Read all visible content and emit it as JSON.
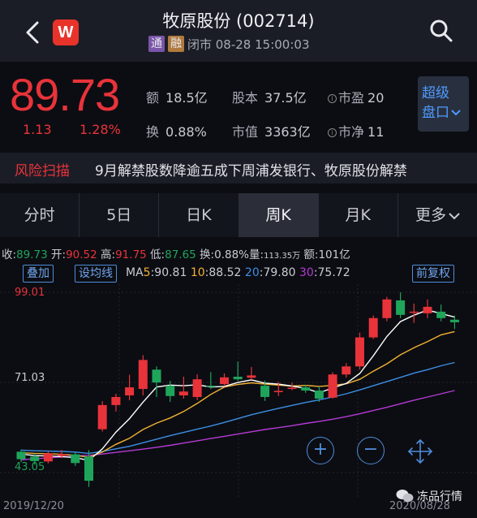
{
  "header": {
    "title": "牧原股份 (002714)",
    "badge_tong": "通",
    "badge_rong": "融",
    "status": "闭市 08-28 15:00:03",
    "logo": "W"
  },
  "quote": {
    "price": "89.73",
    "change": "1.13",
    "change_pct": "1.28%",
    "amount_label": "额",
    "amount": "18.5亿",
    "capital_label": "股本",
    "capital": "37.5亿",
    "pe_label": "市盈",
    "pe": "20",
    "turnover_label": "换",
    "turnover": "0.88%",
    "mcap_label": "市值",
    "mcap": "3363亿",
    "pb_label": "市净",
    "pb": "11",
    "super_line1": "超级",
    "super_line2": "盘口"
  },
  "risk": {
    "label": "风险扫描",
    "text": "9月解禁股数降逾五成下周浦发银行、牧原股份解禁"
  },
  "tabs": [
    "分时",
    "5日",
    "日K",
    "周K",
    "月K",
    "更多"
  ],
  "kinfo": {
    "close_label": "收:",
    "close": "89.73",
    "open_label": "开:",
    "open": "90.52",
    "high_label": "高:",
    "high": "91.75",
    "low_label": "低:",
    "low": "87.65",
    "turn_label": "换:",
    "turn": "0.88%",
    "vol_label": "量:",
    "vol": "113.35万",
    "amt_label": "额:",
    "amt": "101亿"
  },
  "ma": {
    "overlay_btn": "叠加",
    "setma_btn": "设均线",
    "prefix": "MA",
    "ma5_label": "5",
    "ma5": ":90.81",
    "ma10_label": "10",
    "ma10": ":88.52",
    "ma20_label": "20",
    "ma20": ":79.80",
    "ma30_label": "30",
    "ma30": ":75.72",
    "adjust_btn": "前复权"
  },
  "colors": {
    "up": "#e8333a",
    "down": "#1fa55b",
    "ma5": "#ffffff",
    "ma10": "#f2b233",
    "ma20": "#3c8fe6",
    "ma30": "#b53ad6"
  },
  "chart_data": {
    "type": "candlestick",
    "y_top_label": "99.01",
    "y_mid_label": "71.03",
    "y_bottom_label": "43.05",
    "x_start": "2019/12/20",
    "x_end": "2020/08/28",
    "candles": [
      {
        "o": 49.5,
        "c": 47.2,
        "h": 50.2,
        "l": 46.3
      },
      {
        "o": 48.0,
        "c": 46.6,
        "h": 48.9,
        "l": 45.5
      },
      {
        "o": 46.5,
        "c": 49.0,
        "h": 49.6,
        "l": 45.9
      },
      {
        "o": 48.2,
        "c": 48.8,
        "h": 50.1,
        "l": 47.5
      },
      {
        "o": 48.7,
        "c": 46.0,
        "h": 49.3,
        "l": 45.1
      },
      {
        "o": 48.0,
        "c": 40.5,
        "h": 50.0,
        "l": 38.6
      },
      {
        "o": 56.5,
        "c": 64.0,
        "h": 65.2,
        "l": 55.8
      },
      {
        "o": 64.0,
        "c": 66.5,
        "h": 67.5,
        "l": 62.0
      },
      {
        "o": 67.0,
        "c": 69.5,
        "h": 73.4,
        "l": 65.5
      },
      {
        "o": 69.0,
        "c": 78.0,
        "h": 79.5,
        "l": 67.0
      },
      {
        "o": 75.0,
        "c": 71.0,
        "h": 76.0,
        "l": 66.5
      },
      {
        "o": 70.0,
        "c": 66.8,
        "h": 71.5,
        "l": 65.0
      },
      {
        "o": 67.0,
        "c": 68.2,
        "h": 72.8,
        "l": 66.0
      },
      {
        "o": 66.5,
        "c": 72.0,
        "h": 73.5,
        "l": 65.5
      },
      {
        "o": 70.0,
        "c": 69.7,
        "h": 74.2,
        "l": 69.0
      },
      {
        "o": 70.5,
        "c": 72.6,
        "h": 73.8,
        "l": 69.8
      },
      {
        "o": 72.8,
        "c": 72.0,
        "h": 77.5,
        "l": 71.5
      },
      {
        "o": 72.5,
        "c": 73.2,
        "h": 75.8,
        "l": 71.8
      },
      {
        "o": 70.0,
        "c": 66.5,
        "h": 71.6,
        "l": 65.3
      },
      {
        "o": 68.0,
        "c": 68.4,
        "h": 71.2,
        "l": 66.8
      },
      {
        "o": 69.0,
        "c": 69.4,
        "h": 71.0,
        "l": 68.6
      },
      {
        "o": 69.5,
        "c": 68.5,
        "h": 70.3,
        "l": 67.8
      },
      {
        "o": 68.5,
        "c": 66.0,
        "h": 69.8,
        "l": 65.0
      },
      {
        "o": 66.3,
        "c": 73.5,
        "h": 74.2,
        "l": 66.0
      },
      {
        "o": 73.5,
        "c": 76.0,
        "h": 77.0,
        "l": 72.5
      },
      {
        "o": 76.0,
        "c": 85.0,
        "h": 86.5,
        "l": 75.0
      },
      {
        "o": 85.0,
        "c": 91.0,
        "h": 91.8,
        "l": 84.5
      },
      {
        "o": 91.0,
        "c": 96.8,
        "h": 97.6,
        "l": 90.0
      },
      {
        "o": 96.5,
        "c": 92.0,
        "h": 99.0,
        "l": 91.0
      },
      {
        "o": 93.0,
        "c": 93.0,
        "h": 95.5,
        "l": 89.5
      },
      {
        "o": 92.5,
        "c": 94.5,
        "h": 96.8,
        "l": 91.0
      },
      {
        "o": 93.0,
        "c": 91.0,
        "h": 95.2,
        "l": 90.0
      },
      {
        "o": 90.5,
        "c": 89.7,
        "h": 91.8,
        "l": 87.6
      }
    ],
    "ma5": [
      48.8,
      48.3,
      48.2,
      48.0,
      47.7,
      46.8,
      50.4,
      55.6,
      59.8,
      64.9,
      69.6,
      70.2,
      70.0,
      70.3,
      69.6,
      69.8,
      71.0,
      71.8,
      70.8,
      70.5,
      69.9,
      69.2,
      67.8,
      69.3,
      70.7,
      73.8,
      79.3,
      85.3,
      89.9,
      91.9,
      93.5,
      92.4,
      91.3
    ],
    "ma10": [
      49.2,
      49.0,
      48.9,
      48.7,
      48.4,
      47.8,
      49.4,
      51.8,
      53.7,
      56.4,
      58.4,
      60.0,
      62.0,
      64.5,
      67.3,
      69.6,
      70.4,
      70.9,
      70.5,
      70.2,
      69.9,
      70.1,
      69.8,
      70.1,
      70.6,
      72.0,
      74.5,
      76.8,
      79.6,
      81.8,
      83.7,
      85.8,
      86.8
    ],
    "ma20": [
      50.0,
      49.8,
      49.7,
      49.6,
      49.4,
      49.0,
      49.6,
      50.4,
      51.2,
      52.3,
      53.4,
      54.5,
      55.5,
      56.5,
      57.5,
      58.6,
      59.8,
      61.0,
      62.0,
      63.0,
      63.9,
      64.8,
      65.6,
      66.5,
      67.5,
      68.7,
      70.0,
      71.3,
      72.6,
      73.9,
      75.0,
      76.2,
      77.2
    ],
    "ma30": [
      47.0,
      47.3,
      47.6,
      47.9,
      48.2,
      48.4,
      48.8,
      49.3,
      49.8,
      50.3,
      50.9,
      51.5,
      52.2,
      52.9,
      53.6,
      54.3,
      55.0,
      55.7,
      56.4,
      57.0,
      57.6,
      58.3,
      58.9,
      59.6,
      60.4,
      61.3,
      62.3,
      63.3,
      64.4,
      65.5,
      66.5,
      67.5,
      68.5
    ]
  },
  "watermark": "冻品行情"
}
